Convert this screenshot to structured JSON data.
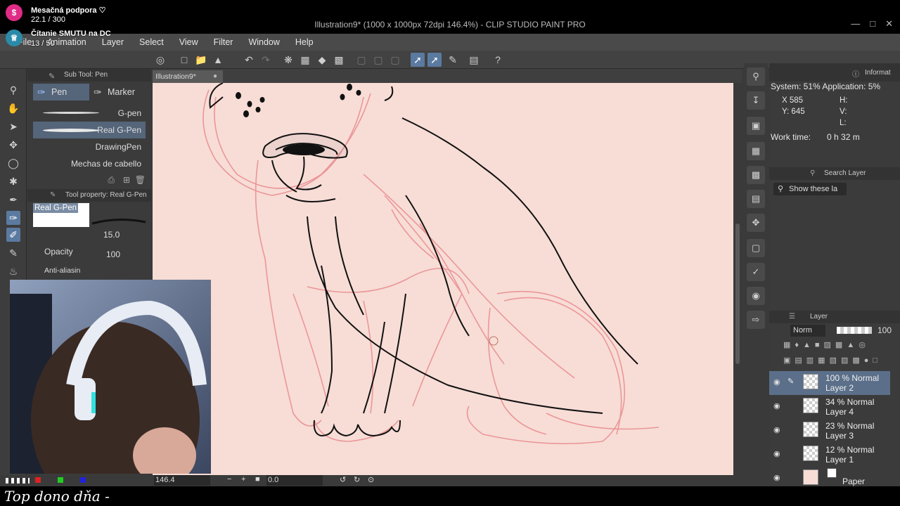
{
  "window": {
    "title": "Illustration9* (1000 x 1000px 72dpi 146.4%)  - CLIP STUDIO PAINT PRO"
  },
  "menu": [
    "File",
    "Animation",
    "Layer",
    "Select",
    "View",
    "Filter",
    "Window",
    "Help"
  ],
  "overlay": {
    "support_label": "Mesačná podpora ♡",
    "support_count": "22.1 / 300",
    "reading_label": "Čítanie SMUTU na DC",
    "reading_count": "13 / 50",
    "caption": "Top dono dňa -"
  },
  "doc_tab": {
    "label": "Illustration9*"
  },
  "subtool": {
    "header": "Sub Tool: Pen",
    "tabs": [
      "Pen",
      "Marker"
    ],
    "brushes": [
      "G-pen",
      "Real G-Pen",
      "DrawingPen",
      "Mechas de cabello"
    ],
    "selected_brush": "Real G-Pen"
  },
  "tool_property": {
    "header": "Tool property: Real G-Pen",
    "preview_label": "Real G-Pen",
    "size_value": "15.0",
    "opacity_label": "Opacity",
    "opacity_value": "100",
    "antialias_label": "Anti-aliasin"
  },
  "status": {
    "zoom": "146.4",
    "rotation": "0.0"
  },
  "info": {
    "header": "Informat",
    "system": "System: 51% Application:  5%",
    "x": "X  585",
    "y": "Y: 645",
    "h": "H:",
    "v": "V:",
    "l": "L:",
    "work_label": "Work time:",
    "work_value": "0 h 32 m"
  },
  "search_layer": {
    "header": "Search Layer",
    "filter": "Show these la"
  },
  "layers": {
    "header": "Layer",
    "blend": "Norm",
    "opacity": "100",
    "items": [
      {
        "line1": "100 % Normal",
        "line2": "Layer 2",
        "selected": true
      },
      {
        "line1": "34 % Normal",
        "line2": "Layer 4",
        "selected": false
      },
      {
        "line1": "23 % Normal",
        "line2": "Layer 3",
        "selected": false
      },
      {
        "line1": "12 % Normal",
        "line2": "Layer 1",
        "selected": false
      },
      {
        "line1": "",
        "line2": "Paper",
        "selected": false
      }
    ]
  },
  "colors": {
    "canvas": "#f7ddd6",
    "sketch": "#e98a8f",
    "ink": "#111111",
    "accent": "#5b7aa0"
  }
}
